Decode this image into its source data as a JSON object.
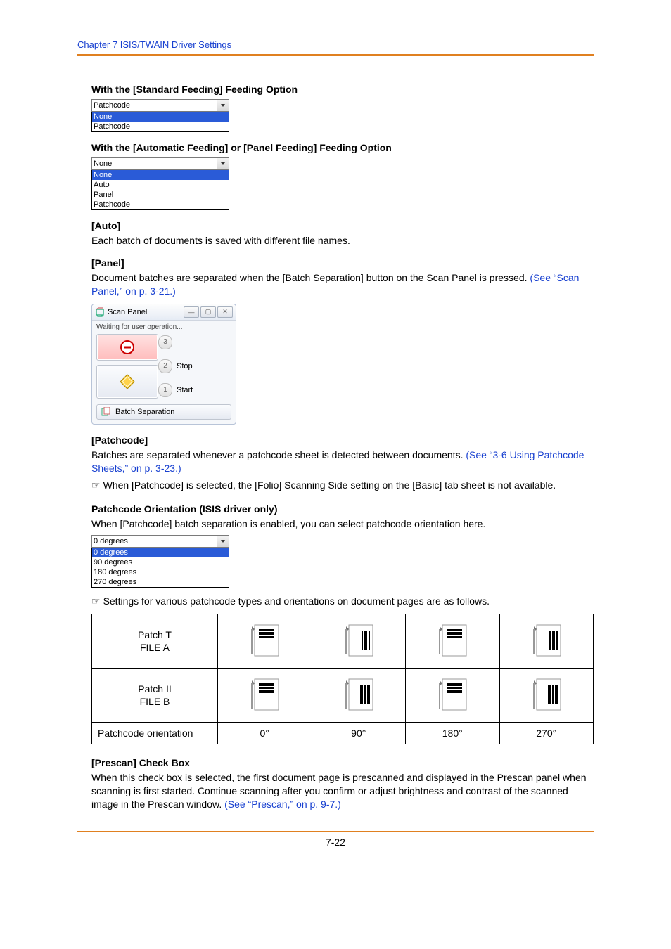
{
  "chapter": "Chapter 7   ISIS/TWAIN Driver Settings",
  "h_standard": "With the [Standard Feeding] Feeding Option",
  "dd_standard": {
    "selected": "Patchcode",
    "opts": [
      "None",
      "Patchcode"
    ]
  },
  "h_auto_panel": "With the [Automatic Feeding] or [Panel Feeding] Feeding Option",
  "dd_auto": {
    "selected": "None",
    "opts": [
      "None",
      "Auto",
      "Panel",
      "Patchcode"
    ]
  },
  "auto_head": "[Auto]",
  "auto_text": "Each batch of documents is saved with different file names.",
  "panel_head": "[Panel]",
  "panel_text": "Document batches are separated when the [Batch Separation] button on the Scan Panel is pressed. ",
  "panel_link": "(See “Scan Panel,” on p. 3-21.)",
  "scanpanel": {
    "title": "Scan Panel",
    "status": "Waiting for user operation...",
    "n3": "3",
    "n2": "2",
    "n1": "1",
    "stop": "Stop",
    "start": "Start",
    "batch": "Batch Separation"
  },
  "patch_head": "[Patchcode]",
  "patch_text_a": "Batches are separated whenever a patchcode sheet is detected between documents. ",
  "patch_link": "(See “3-6 Using Patchcode Sheets,” on p. 3-23.)",
  "patch_note": "When [Patchcode] is selected, the [Folio] Scanning Side setting on the [Basic] tab sheet is not available.",
  "orient_head": "Patchcode Orientation (ISIS driver only)",
  "orient_text": "When [Patchcode] batch separation is enabled, you can select patchcode orientation here.",
  "dd_orient": {
    "selected": "0 degrees",
    "opts": [
      "0 degrees",
      "90 degrees",
      "180 degrees",
      "270 degrees"
    ]
  },
  "orient_note": "Settings for various patchcode types and orientations on document pages are as follows.",
  "table": {
    "row0": "Patch T\nFILE A",
    "row1": "Patch II\nFILE B",
    "row2": "Patchcode orientation",
    "cols": [
      "0°",
      "90°",
      "180°",
      "270°"
    ]
  },
  "prescan_head": "[Prescan] Check Box",
  "prescan_text": "When this check box is selected, the first document page is prescanned and displayed in the Prescan panel when scanning is first started. Continue scanning after you confirm or adjust brightness and contrast of the scanned image in the Prescan window. ",
  "prescan_link": "(See “Prescan,” on p. 9-7.)",
  "pagenum": "7-22"
}
